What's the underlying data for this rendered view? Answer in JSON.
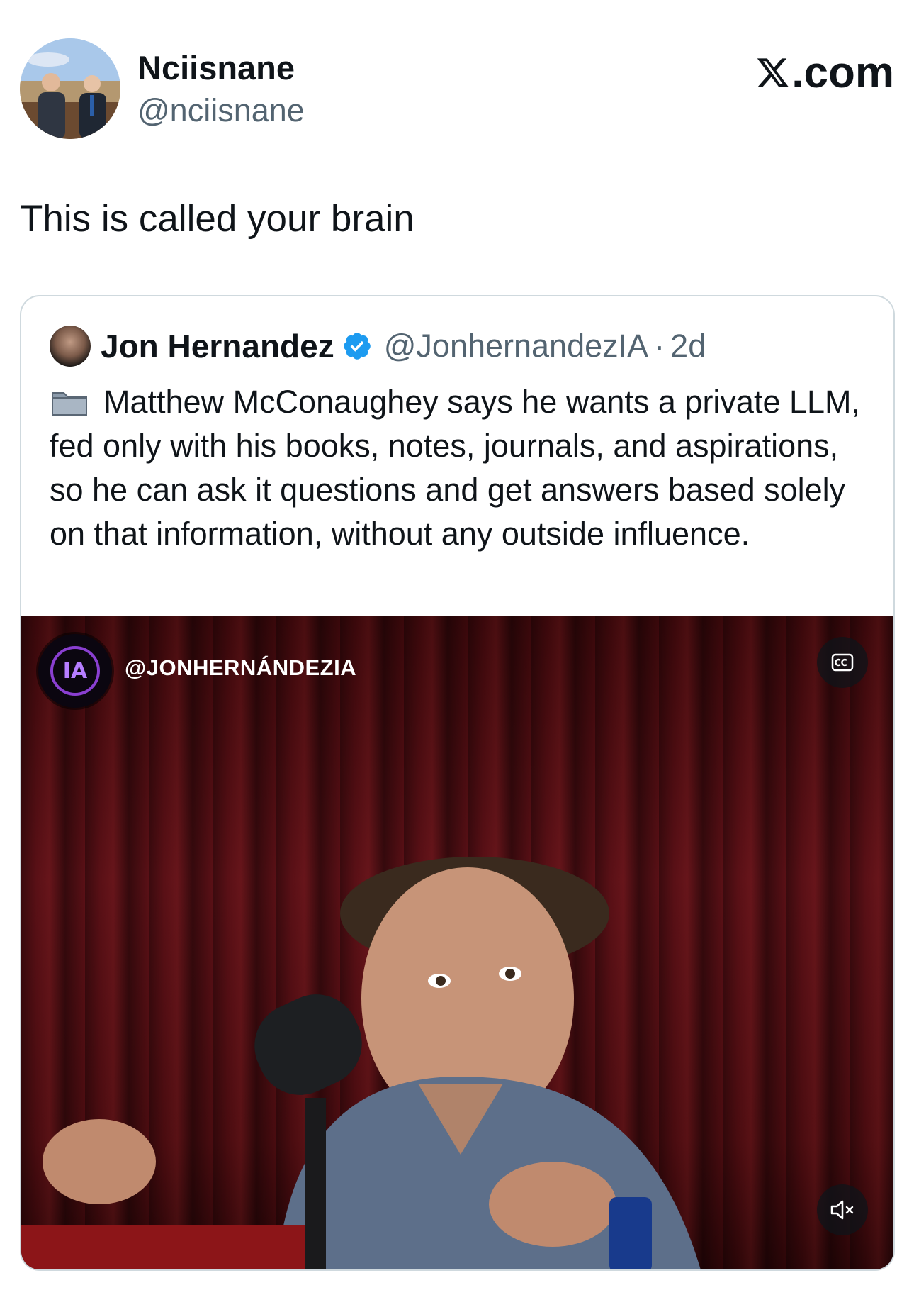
{
  "author": {
    "name": "Nciisnane",
    "handle": "@nciisnane",
    "avatar_icon": "profile-photo"
  },
  "brand": {
    "logo_icon": "x-logo-icon",
    "suffix": ".com"
  },
  "tweet": {
    "text": "This is called your brain"
  },
  "quoted_tweet": {
    "author_name": "Jon Hernandez",
    "verified": true,
    "handle": "@JonhernandezIA",
    "separator": "·",
    "time": "2d",
    "text_icon": "folder-icon",
    "text": "Matthew McConaughey says he wants a private LLM, fed only with his books, notes, journals, and aspirations, so he can ask it questions and get answers based solely on that information, without any outside influence."
  },
  "video": {
    "channel_badge_text": "IA",
    "channel_name": "@JONHERNÁNDEZIA",
    "cc_icon": "captions-icon",
    "mute_icon": "volume-muted-icon"
  },
  "colors": {
    "text_primary": "#0f1419",
    "text_secondary": "#536471",
    "border": "#cfd9de",
    "verified_blue": "#1d9bf0",
    "curtain_red": "#5a1016"
  }
}
